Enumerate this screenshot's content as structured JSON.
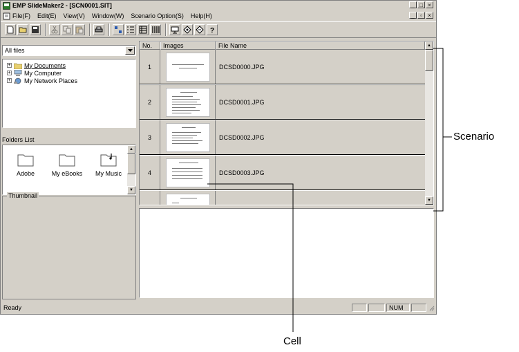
{
  "window": {
    "title": "EMP SlideMaker2 - [SCN0001.SIT]",
    "caption_buttons": [
      "_",
      "□",
      "×"
    ],
    "doc_caption_buttons": [
      "_",
      "▫",
      "×"
    ]
  },
  "menu": [
    "File(F)",
    "Edit(E)",
    "View(V)",
    "Window(W)",
    "Scenario Option(S)",
    "Help(H)"
  ],
  "toolbar": {
    "buttons": [
      {
        "icon": "new-file-icon"
      },
      {
        "icon": "open-folder-icon"
      },
      {
        "icon": "save-disk-icon"
      },
      {
        "icon": "cut-icon",
        "disabled": true
      },
      {
        "icon": "copy-icon",
        "disabled": true
      },
      {
        "icon": "paste-icon",
        "disabled": true
      },
      {
        "icon": "print-icon"
      },
      {
        "icon": "small-icons-view-icon"
      },
      {
        "icon": "list-view-icon"
      },
      {
        "icon": "details-view-icon"
      },
      {
        "icon": "thumbnail-view-icon"
      },
      {
        "icon": "preview-icon"
      },
      {
        "icon": "send-icon"
      },
      {
        "icon": "receive-icon"
      },
      {
        "icon": "help-icon"
      }
    ]
  },
  "left": {
    "drive_select": "All files",
    "tree": [
      {
        "label": "My Documents",
        "selected": true
      },
      {
        "label": "My Computer"
      },
      {
        "label": "My Network Places"
      }
    ],
    "folders_label": "Folders List",
    "folders": [
      "Adobe",
      "My eBooks",
      "My Music"
    ],
    "thumbnail_label": "Thumbnail"
  },
  "grid": {
    "columns": [
      "No.",
      "Images",
      "File Name"
    ],
    "rows": [
      {
        "no": "1",
        "file": "DCSD0000.JPG"
      },
      {
        "no": "2",
        "file": "DCSD0001.JPG"
      },
      {
        "no": "3",
        "file": "DCSD0002.JPG"
      },
      {
        "no": "4",
        "file": "DCSD0003.JPG"
      }
    ]
  },
  "status": {
    "text": "Ready",
    "num": "NUM"
  },
  "callouts": {
    "scenario": "Scenario",
    "cell": "Cell"
  }
}
